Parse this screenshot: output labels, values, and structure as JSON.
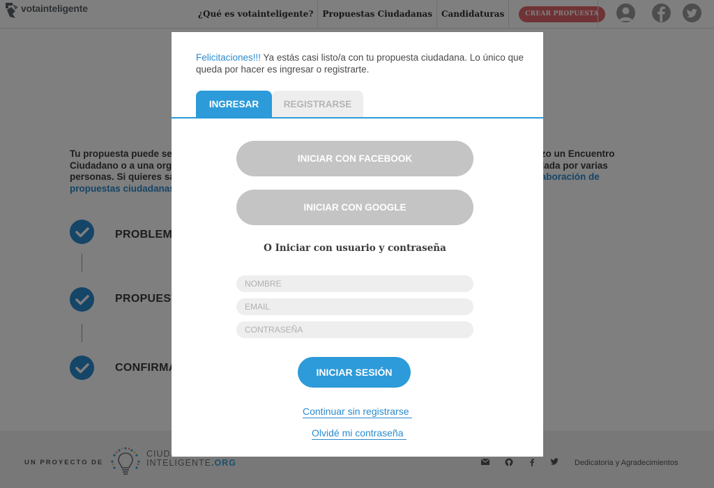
{
  "header": {
    "logo_text": "votainteligente",
    "nav": [
      "¿Qué es votainteligente?",
      "Propuestas Ciudadanas",
      "Candidaturas"
    ],
    "cta": "CREAR PROPUESTA",
    "icons": [
      "user-icon",
      "facebook-icon",
      "twitter-icon"
    ]
  },
  "page": {
    "intro_line1": "Tu propuesta puede ser",
    "intro_line1_right": "izo un Encuentro",
    "intro_line2": "Ciudadano o a una orga",
    "intro_line2_right": "dada por varias",
    "intro_line3": "personas. Si quieres sa",
    "intro_line3_right_link": "laboración de",
    "intro_line4_link": "propuestas ciudadanas",
    "steps": [
      "PROBLEMA",
      "PROPUEST",
      "CONFIRMA"
    ]
  },
  "modal": {
    "msg_highlight": "Felicitaciones!!!",
    "msg_rest": " Ya estás casi listo/a con tu propuesta ciudadana. Lo único que queda por hacer es ingresar o registrarte.",
    "tab_login": "INGRESAR",
    "tab_register": "REGISTRARSE",
    "facebook_btn": "INICIAR CON FACEBOOK",
    "google_btn": "INICIAR CON GOOGLE",
    "alt_login": "O Iniciar con usuario y contraseña",
    "name_placeholder": "NOMBRE",
    "email_placeholder": "EMAIL",
    "password_placeholder": "CONTRASEÑA",
    "submit": "INICIAR SESIÓN",
    "continue_link": "Continuar sin registrarse",
    "forgot_link": "Olvidé mi contraseña"
  },
  "footer": {
    "project_label": "UN PROYECTO DE",
    "org_line1": "CIUDADANO",
    "org_line2": "INTELIGENTE",
    "org_suffix": ".ORG",
    "icons": [
      "mail-icon",
      "github-icon",
      "facebook-icon",
      "twitter-icon"
    ],
    "credits": "Dedicatoria y Agradecimientos"
  },
  "colors": {
    "accent": "#2d9ad9",
    "cta": "#e0666a",
    "overlay": "rgba(0,0,0,0.5)"
  }
}
